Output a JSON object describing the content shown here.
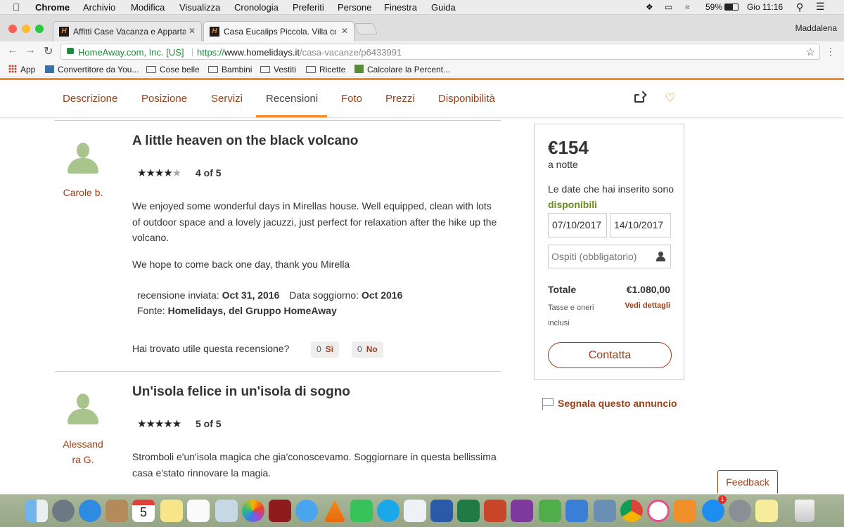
{
  "menubar": {
    "app": "Chrome",
    "items": [
      "Archivio",
      "Modifica",
      "Visualizza",
      "Cronologia",
      "Preferiti",
      "Persone",
      "Finestra",
      "Guida"
    ],
    "battery": "59%",
    "clock": "Gio 11:16"
  },
  "browser": {
    "tabs": [
      {
        "title": "Affitti Case Vacanza e Apparta"
      },
      {
        "title": "Casa Eucalips Piccola. Villa co"
      }
    ],
    "profile": "Maddalena",
    "address": {
      "org": "HomeAway.com, Inc. [US]",
      "url_scheme": "https://",
      "url_host": "www.homelidays.it",
      "url_path": "/casa-vacanze/p6433991"
    },
    "bookmarks": [
      "App",
      "Convertitore da You...",
      "Cose belle",
      "Bambini",
      "Vestiti",
      "Ricette",
      "Calcolare la Percent..."
    ]
  },
  "site_nav": {
    "tabs": [
      "Descrizione",
      "Posizione",
      "Servizi",
      "Recensioni",
      "Foto",
      "Prezzi",
      "Disponibilità"
    ],
    "active": "Recensioni"
  },
  "reviews": [
    {
      "author": "Carole b.",
      "title": "A little heaven on the black volcano",
      "rating": 4,
      "rating_text": "4 of 5",
      "body": [
        "We enjoyed some wonderful days in Mirellas house. Well equipped, clean with lots of outdoor space and a lovely jacuzzi, just perfect for relaxation after the hike up the volcano.",
        "We hope to come back one day, thank you Mirella"
      ],
      "sent_label": "recensione inviata:",
      "sent_date": "Oct 31, 2016",
      "stay_label": "Data soggiorno:",
      "stay_date": "Oct 2016",
      "source_label": "Fonte:",
      "source": "Homelidays, del Gruppo HomeAway",
      "helpful_question": "Hai trovato utile questa recensione?",
      "yes_count": "0",
      "yes_label": "Sì",
      "no_count": "0",
      "no_label": "No"
    },
    {
      "author_line1": "Alessand",
      "author_line2": "ra G.",
      "title": "Un'isola felice in un'isola di sogno",
      "rating": 5,
      "rating_text": "5 of 5",
      "body": [
        "Stromboli e'un'isola magica che gia'conoscevamo. Soggiornare in questa bellissima casa e'stato rinnovare la magia."
      ]
    }
  ],
  "booking": {
    "price": "€154",
    "per_night": "a notte",
    "avail_prefix": "Le date che hai inserito sono",
    "avail_word": "disponibili",
    "checkin": "07/10/2017",
    "checkout": "14/10/2017",
    "guests_placeholder": "Ospiti (obbligatorio)",
    "total_label": "Totale",
    "total_value": "€1.080,00",
    "taxes_note": "Tasse e oneri inclusi",
    "details_link": "Vedi dettagli",
    "contact_button": "Contatta"
  },
  "report_link": "Segnala questo annuncio",
  "feedback_button": "Feedback",
  "dock": {
    "apps": [
      "finder-icon",
      "launchpad-icon",
      "safari-icon",
      "contacts-icon",
      "calendar-icon",
      "notes-icon",
      "reminders-icon",
      "preview-icon",
      "photos-icon",
      "photo-booth-icon",
      "messages-icon",
      "vlc-icon",
      "facetime-icon",
      "skype-icon",
      "textedit-icon",
      "word-icon",
      "excel-icon",
      "powerpoint-icon",
      "onenote-icon",
      "numbers-icon",
      "keynote-icon",
      "photo-icon",
      "chrome-icon",
      "itunes-icon",
      "ibooks-icon",
      "app-store-icon",
      "system-preferences-icon",
      "stickies-icon",
      "trash-icon"
    ],
    "calendar_day": "5",
    "app_store_badge": "1"
  }
}
